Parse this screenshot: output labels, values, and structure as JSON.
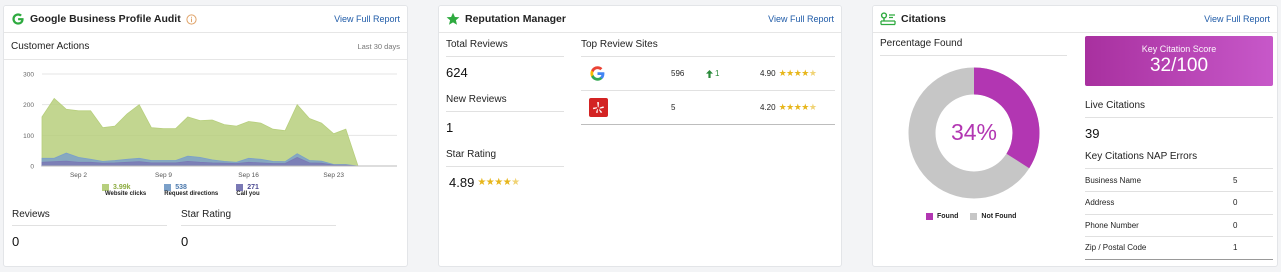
{
  "gbp": {
    "title": "Google Business Profile Audit",
    "info_icon": "info-circle-icon",
    "view_report": "View Full Report",
    "customer_actions": "Customer Actions",
    "period": "Last 30 days",
    "reviews_label": "Reviews",
    "reviews_value": "0",
    "star_rating_label": "Star Rating",
    "star_rating_value": "0",
    "legend": [
      {
        "value": "3.99k",
        "label": "Website clicks",
        "color": "#b7cf7d",
        "text_color": "#8cab3f"
      },
      {
        "value": "538",
        "label": "Request directions",
        "color": "#7ba0c9",
        "text_color": "#4a78ad"
      },
      {
        "value": "271",
        "label": "Call you",
        "color": "#7a79b5",
        "text_color": "#4c4a92"
      }
    ]
  },
  "chart_data": {
    "type": "area",
    "title": "",
    "xlabel": "",
    "ylabel": "",
    "ylim": [
      0,
      300
    ],
    "y_ticks": [
      "0",
      "100",
      "200",
      "300"
    ],
    "x_ticks": [
      "Sep 2",
      "Sep 9",
      "Sep 16",
      "Sep 23"
    ],
    "x_tick_index": [
      3,
      10,
      17,
      24
    ],
    "series": [
      {
        "name": "Website clicks",
        "color": "#b7cf7d",
        "values": [
          160,
          220,
          185,
          180,
          180,
          125,
          130,
          170,
          200,
          125,
          122,
          122,
          160,
          148,
          150,
          135,
          130,
          145,
          140,
          120,
          115,
          200,
          155,
          140,
          105,
          120,
          0
        ]
      },
      {
        "name": "Request directions",
        "color": "#7ba0c9",
        "values": [
          25,
          25,
          42,
          28,
          22,
          15,
          18,
          22,
          25,
          18,
          18,
          18,
          32,
          28,
          20,
          15,
          12,
          25,
          22,
          15,
          14,
          40,
          18,
          16,
          5,
          5,
          0
        ]
      },
      {
        "name": "Call you",
        "color": "#7a79b5",
        "values": [
          12,
          14,
          16,
          12,
          12,
          9,
          10,
          12,
          14,
          10,
          10,
          10,
          15,
          12,
          10,
          9,
          8,
          12,
          10,
          8,
          8,
          28,
          10,
          9,
          3,
          3,
          0
        ]
      }
    ]
  },
  "rep": {
    "title": "Reputation Manager",
    "view_report": "View Full Report",
    "total_reviews_label": "Total Reviews",
    "total_reviews": "624",
    "new_reviews_label": "New Reviews",
    "new_reviews": "1",
    "star_rating_label": "Star Rating",
    "star_rating": "4.89",
    "star_rating_stars": "★★★★",
    "top_sites_label": "Top Review Sites",
    "sites": [
      {
        "icon": "google-icon",
        "count": "596",
        "change": "1",
        "rating": "4.90",
        "stars": "★★★★"
      },
      {
        "icon": "yelp-icon",
        "count": "5",
        "change": "",
        "rating": "4.20",
        "stars": "★★★★"
      }
    ]
  },
  "cit": {
    "title": "Citations",
    "view_report": "View Full Report",
    "percentage_found_label": "Percentage Found",
    "percent": "34%",
    "found_fraction": 0.34,
    "found_color": "#b236b2",
    "not_found_color": "#c6c6c6",
    "legend_found": "Found",
    "legend_not_found": "Not Found",
    "score_label": "Key Citation Score",
    "score_value": "32/100",
    "live_label": "Live Citations",
    "live_value": "39",
    "nap_label": "Key Citations NAP Errors",
    "nap_rows": [
      {
        "name": "Business Name",
        "count": "5"
      },
      {
        "name": "Address",
        "count": "0"
      },
      {
        "name": "Phone Number",
        "count": "0"
      },
      {
        "name": "Zip / Postal Code",
        "count": "1"
      }
    ]
  }
}
